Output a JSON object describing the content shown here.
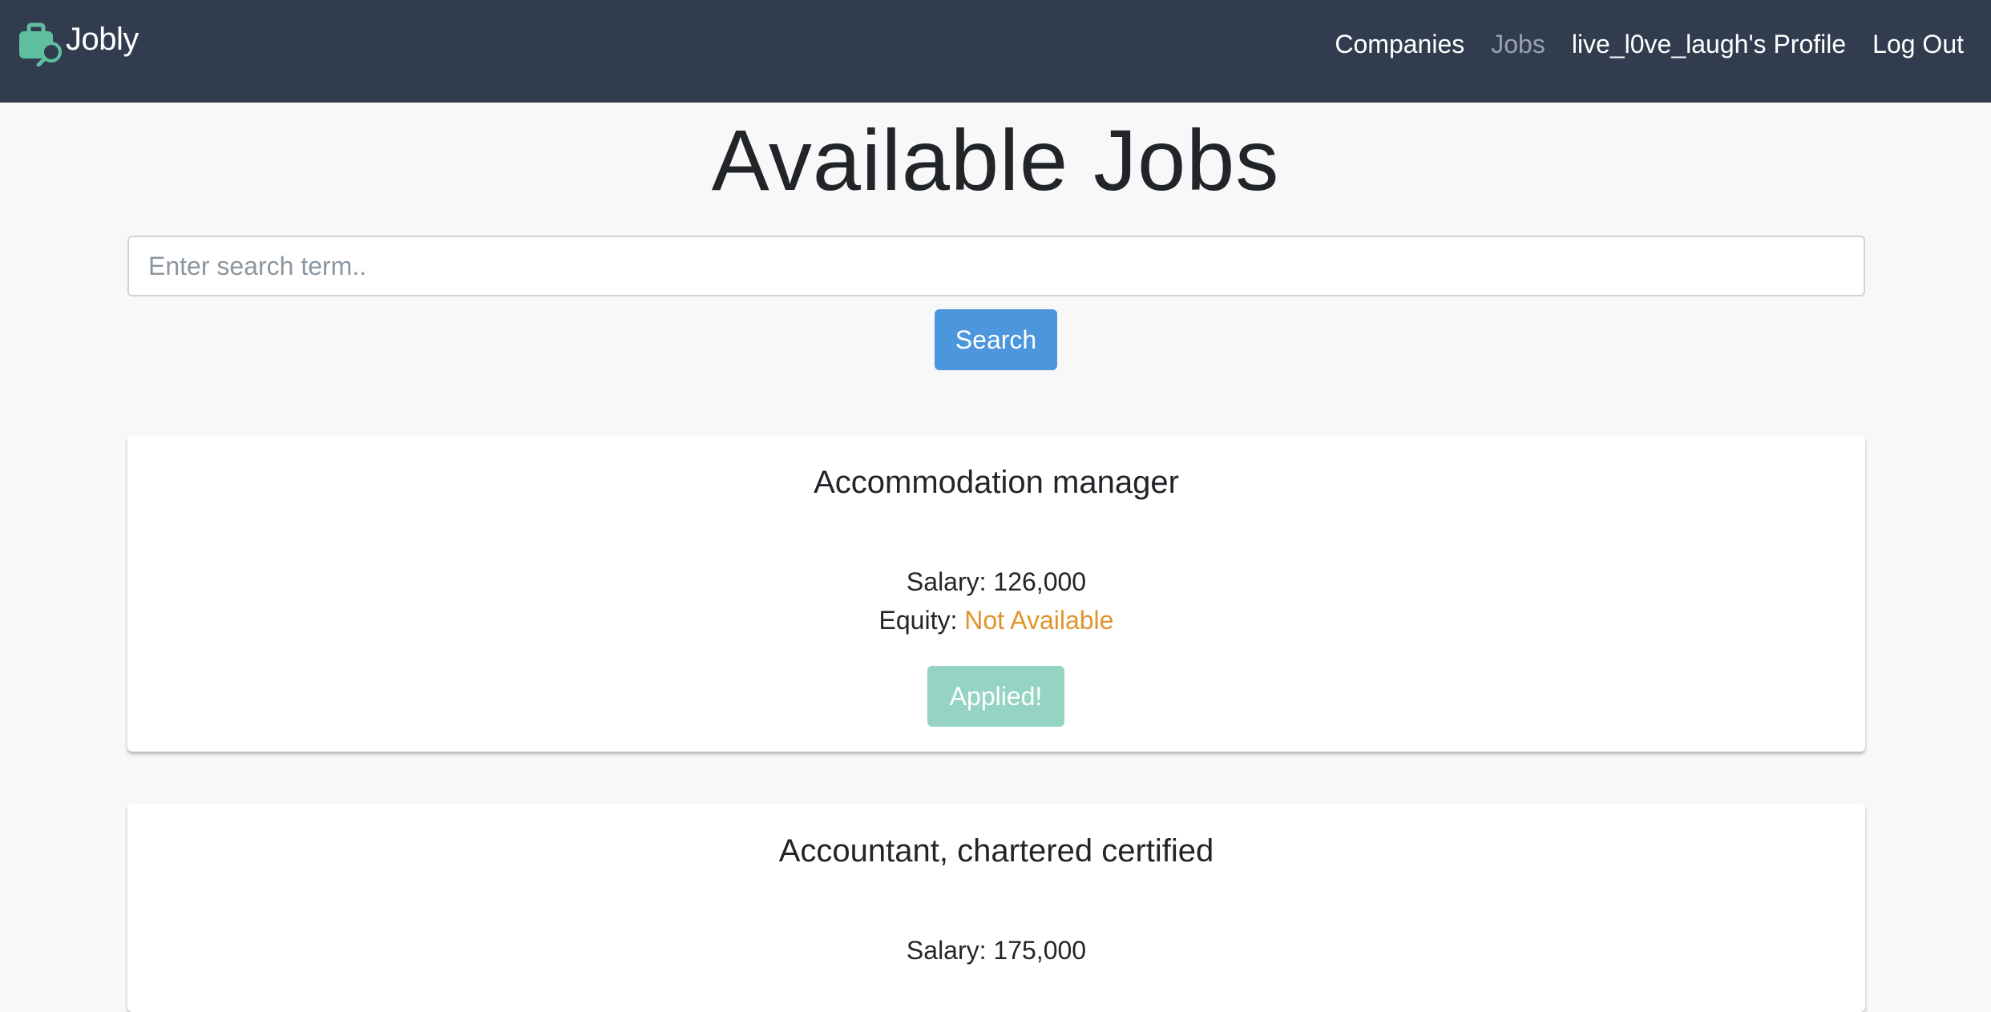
{
  "navbar": {
    "brand": "Jobly",
    "logo_icon": "briefcase-search-icon",
    "links": {
      "companies": "Companies",
      "jobs": "Jobs",
      "profile": "live_l0ve_laugh's Profile",
      "logout": "Log Out"
    },
    "active_link": "jobs"
  },
  "main": {
    "title": "Available Jobs",
    "search": {
      "placeholder": "Enter search term..",
      "value": "",
      "button_label": "Search"
    },
    "jobs": [
      {
        "title": "Accommodation manager",
        "salary_label": "Salary: ",
        "salary": "126,000",
        "equity_label": "Equity: ",
        "equity": "Not Available",
        "button_label": "Applied!"
      },
      {
        "title": "Accountant, chartered certified",
        "salary_label": "Salary: ",
        "salary": "175,000"
      }
    ]
  },
  "colors": {
    "navbar_bg": "#313d4f",
    "page_bg": "#f8f8f8",
    "search_button": "#4b96dc",
    "applied_button": "#95d3c2",
    "equity_warning": "#e0942b",
    "logo_teal": "#5fbf9f"
  }
}
